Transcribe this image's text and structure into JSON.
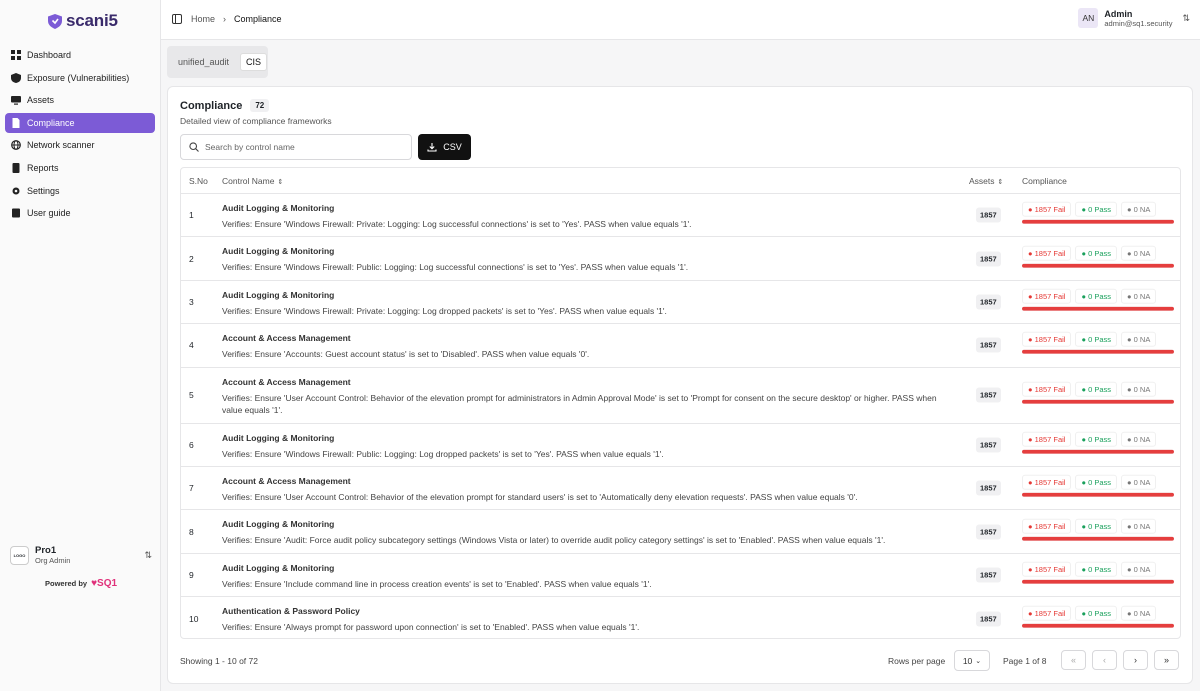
{
  "brand": {
    "name": "scani5",
    "powered_by": "Powered by",
    "partner": "SQ1"
  },
  "sidebar": {
    "items": [
      {
        "label": "Dashboard",
        "icon": "dashboard-icon"
      },
      {
        "label": "Exposure (Vulnerabilities)",
        "icon": "shield-icon"
      },
      {
        "label": "Assets",
        "icon": "monitor-icon"
      },
      {
        "label": "Compliance",
        "icon": "file-icon",
        "active": true
      },
      {
        "label": "Network scanner",
        "icon": "network-icon"
      },
      {
        "label": "Reports",
        "icon": "report-icon"
      },
      {
        "label": "Settings",
        "icon": "gear-icon"
      },
      {
        "label": "User guide",
        "icon": "book-icon"
      }
    ],
    "org": {
      "logo": "LOGO",
      "name": "Pro1",
      "role": "Org Admin"
    }
  },
  "header": {
    "breadcrumb": [
      "Home",
      "Compliance"
    ],
    "user": {
      "initials": "AN",
      "name": "Admin",
      "email": "admin@sq1.security"
    }
  },
  "frameworks": {
    "tabs": [
      "unified_audit",
      "CIS"
    ],
    "active": "CIS"
  },
  "compliance": {
    "title": "Compliance",
    "count": "72",
    "subtitle": "Detailed view of compliance frameworks",
    "search_placeholder": "Search by control name",
    "csv_label": "CSV",
    "columns": {
      "no": "S.No",
      "name": "Control Name",
      "assets": "Assets",
      "compliance": "Compliance"
    },
    "rows": [
      {
        "no": "1",
        "category": "Audit Logging & Monitoring",
        "desc": "Verifies: Ensure 'Windows Firewall: Private: Logging: Log successful connections' is set to 'Yes'. PASS when value equals '1'.",
        "assets": "1857",
        "fail": "1857 Fail",
        "pass": "0 Pass",
        "na": "0 NA",
        "fail_fraction": 1.0
      },
      {
        "no": "2",
        "category": "Audit Logging & Monitoring",
        "desc": "Verifies: Ensure 'Windows Firewall: Public: Logging: Log successful connections' is set to 'Yes'. PASS when value equals '1'.",
        "assets": "1857",
        "fail": "1857 Fail",
        "pass": "0 Pass",
        "na": "0 NA",
        "fail_fraction": 1.0
      },
      {
        "no": "3",
        "category": "Audit Logging & Monitoring",
        "desc": "Verifies: Ensure 'Windows Firewall: Private: Logging: Log dropped packets' is set to 'Yes'. PASS when value equals '1'.",
        "assets": "1857",
        "fail": "1857 Fail",
        "pass": "0 Pass",
        "na": "0 NA",
        "fail_fraction": 1.0
      },
      {
        "no": "4",
        "category": "Account & Access Management",
        "desc": "Verifies: Ensure 'Accounts: Guest account status' is set to 'Disabled'. PASS when value equals '0'.",
        "assets": "1857",
        "fail": "1857 Fail",
        "pass": "0 Pass",
        "na": "0 NA",
        "fail_fraction": 1.0
      },
      {
        "no": "5",
        "category": "Account & Access Management",
        "desc": "Verifies: Ensure 'User Account Control: Behavior of the elevation prompt for administrators in Admin Approval Mode' is set to 'Prompt for consent on the secure desktop' or higher. PASS when value equals '1'.",
        "assets": "1857",
        "fail": "1857 Fail",
        "pass": "0 Pass",
        "na": "0 NA",
        "fail_fraction": 1.0,
        "tall": true
      },
      {
        "no": "6",
        "category": "Audit Logging & Monitoring",
        "desc": "Verifies: Ensure 'Windows Firewall: Public: Logging: Log dropped packets' is set to 'Yes'. PASS when value equals '1'.",
        "assets": "1857",
        "fail": "1857 Fail",
        "pass": "0 Pass",
        "na": "0 NA",
        "fail_fraction": 1.0
      },
      {
        "no": "7",
        "category": "Account & Access Management",
        "desc": "Verifies: Ensure 'User Account Control: Behavior of the elevation prompt for standard users' is set to 'Automatically deny elevation requests'. PASS when value equals '0'.",
        "assets": "1857",
        "fail": "1857 Fail",
        "pass": "0 Pass",
        "na": "0 NA",
        "fail_fraction": 1.0
      },
      {
        "no": "8",
        "category": "Audit Logging & Monitoring",
        "desc": "Verifies: Ensure 'Audit: Force audit policy subcategory settings (Windows Vista or later) to override audit policy category settings' is set to 'Enabled'. PASS when value equals '1'.",
        "assets": "1857",
        "fail": "1857 Fail",
        "pass": "0 Pass",
        "na": "0 NA",
        "fail_fraction": 1.0
      },
      {
        "no": "9",
        "category": "Audit Logging & Monitoring",
        "desc": "Verifies: Ensure 'Include command line in process creation events' is set to 'Enabled'. PASS when value equals '1'.",
        "assets": "1857",
        "fail": "1857 Fail",
        "pass": "0 Pass",
        "na": "0 NA",
        "fail_fraction": 1.0
      },
      {
        "no": "10",
        "category": "Authentication & Password Policy",
        "desc": "Verifies: Ensure 'Always prompt for password upon connection' is set to 'Enabled'. PASS when value equals '1'.",
        "assets": "1857",
        "fail": "1857 Fail",
        "pass": "0 Pass",
        "na": "0 NA",
        "fail_fraction": 1.0
      }
    ],
    "footer": {
      "showing": "Showing 1 - 10 of 72",
      "rows_per_page_label": "Rows per page",
      "rows_per_page": "10",
      "page_info": "Page 1 of 8"
    }
  },
  "colors": {
    "accent": "#7c5bd6",
    "fail": "#e53e3e",
    "pass": "#1aa05c"
  }
}
